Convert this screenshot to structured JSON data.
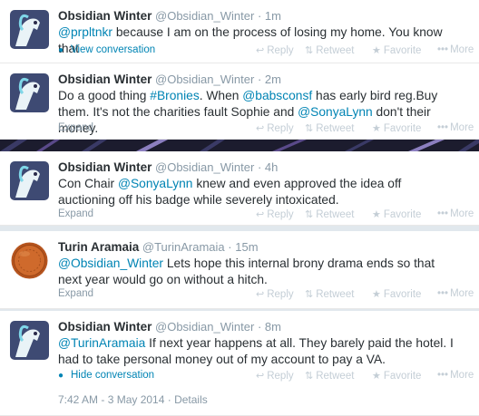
{
  "actions": {
    "reply": "Reply",
    "retweet": "Retweet",
    "favorite": "Favorite",
    "more": "More"
  },
  "tweets": [
    {
      "name": "Obsidian Winter",
      "handle": "@Obsidian_Winter",
      "sep": "·",
      "time": "1m",
      "mention1": "@prpltnkr",
      "text1": " because I am on the process of losing my home. You know that",
      "footer": "View conversation",
      "footer_icon": "conversation-icon"
    },
    {
      "name": "Obsidian Winter",
      "handle": "@Obsidian_Winter",
      "sep": "·",
      "time": "2m",
      "text1": "Do a good thing ",
      "hashtag": "#Bronies",
      "text2": ". When ",
      "mention1": "@babsconsf",
      "text3": " has early bird reg.Buy them. It's not the charities fault Sophie and ",
      "mention2": "@SonyaLynn",
      "text4": " don't their money.",
      "footer": "Expand"
    },
    {
      "name": "Obsidian Winter",
      "handle": "@Obsidian_Winter",
      "sep": "·",
      "time": "4h",
      "text1": "Con Chair ",
      "mention1": "@SonyaLynn",
      "text2": " knew and even approved the idea off auctioning off his badge while severely intoxicated.",
      "footer": "Expand"
    },
    {
      "name": "Turin Aramaia",
      "handle": "@TurinAramaia",
      "sep": "·",
      "time": "15m",
      "mention1": "@Obsidian_Winter",
      "text1": " Lets hope this internal brony drama ends so that next year would go on without a hitch.",
      "footer": "Expand"
    },
    {
      "name": "Obsidian Winter",
      "handle": "@Obsidian_Winter",
      "sep": "·",
      "time": "8m",
      "mention1": "@TurinAramaia",
      "text1": " If next year happens at all. They barely paid the hotel. I had to take personal money out of my account to pay a VA.",
      "footer": "Hide conversation",
      "footer_icon": "conversation-icon",
      "details": "7:42 AM - 3 May 2014 · Details"
    }
  ]
}
